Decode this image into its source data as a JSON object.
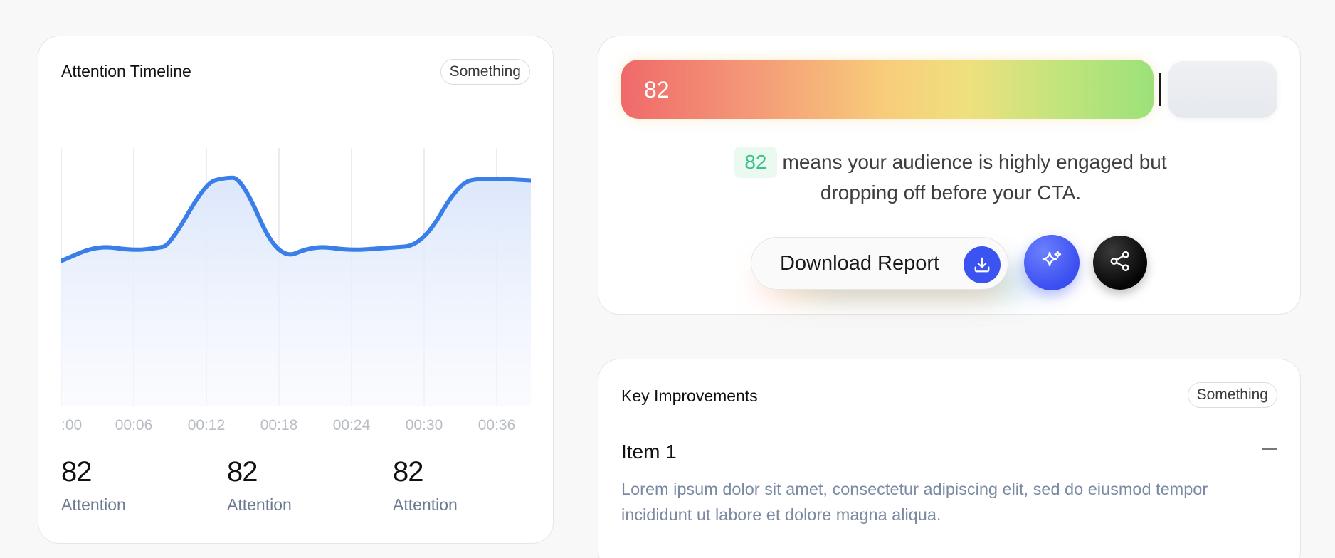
{
  "timeline": {
    "title": "Attention Timeline",
    "badge": "Something",
    "stats": [
      {
        "value": "82",
        "label": "Attention"
      },
      {
        "value": "82",
        "label": "Attention"
      },
      {
        "value": "82",
        "label": "Attention"
      }
    ]
  },
  "chart_data": {
    "type": "area",
    "x_ticks": [
      ":00",
      "00:06",
      "00:12",
      "00:18",
      "00:24",
      "00:30",
      "00:36"
    ],
    "y_range": [
      0,
      100
    ],
    "series": [
      {
        "x": [
          0,
          3,
          6,
          8,
          9,
          12,
          13.5,
          15,
          18,
          21,
          24,
          27,
          30,
          33,
          35,
          39
        ],
        "y": [
          56,
          62,
          60,
          61,
          62,
          86,
          88,
          88,
          56,
          62,
          60,
          61,
          62,
          86,
          88,
          87
        ]
      }
    ],
    "grid": "vertical",
    "line_color": "#3a7ee9",
    "fill_color": "#dfe9fb"
  },
  "score": {
    "value": "82",
    "fraction": 0.82,
    "badge": "82",
    "description": "means your audience is highly engaged but dropping off before your CTA."
  },
  "actions": {
    "download_label": "Download Report",
    "download_icon": "download-icon",
    "ai_icon": "sparkle-icon",
    "share_icon": "share-icon",
    "primary_color": "#3b54f1"
  },
  "improvements": {
    "title": "Key Improvements",
    "badge": "Something",
    "items": [
      {
        "title": "Item 1",
        "body": "Lorem ipsum dolor sit amet, consectetur adipiscing elit, sed do eiusmod tempor incididunt ut labore et dolore magna aliqua."
      }
    ]
  }
}
